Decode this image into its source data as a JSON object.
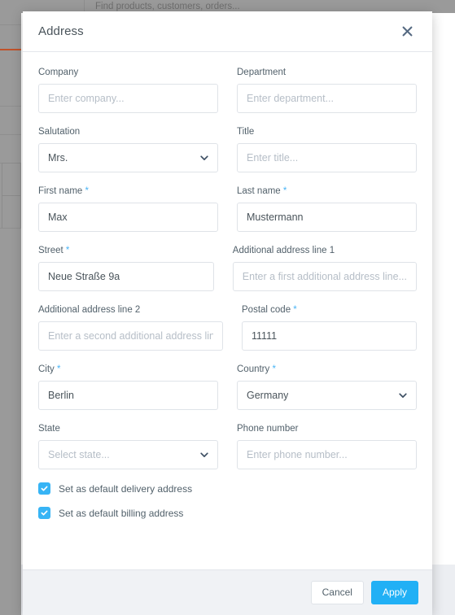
{
  "background": {
    "search_placeholder": "Find products, customers, orders...",
    "accent_color": "#c0522a",
    "overlay_color": "#9a9a9a"
  },
  "modal": {
    "title": "Address",
    "close_icon": "close-icon",
    "accent_color": "#21b0f5",
    "required_marker": "*",
    "rows": [
      {
        "left": {
          "label": "Company",
          "required": false,
          "type": "text",
          "value": "",
          "placeholder": "Enter company..."
        },
        "right": {
          "label": "Department",
          "required": false,
          "type": "text",
          "value": "",
          "placeholder": "Enter department..."
        }
      },
      {
        "left": {
          "label": "Salutation",
          "required": false,
          "type": "select",
          "value": "Mrs.",
          "placeholder": ""
        },
        "right": {
          "label": "Title",
          "required": false,
          "type": "text",
          "value": "",
          "placeholder": "Enter title..."
        }
      },
      {
        "left": {
          "label": "First name",
          "required": true,
          "type": "text",
          "value": "Max",
          "placeholder": ""
        },
        "right": {
          "label": "Last name",
          "required": true,
          "type": "text",
          "value": "Mustermann",
          "placeholder": ""
        }
      },
      {
        "left": {
          "label": "Street",
          "required": true,
          "type": "text",
          "value": "Neue Straße 9a",
          "placeholder": ""
        },
        "right": {
          "label": "Additional address line 1",
          "required": false,
          "type": "text",
          "value": "",
          "placeholder": "Enter a first additional address line..."
        }
      },
      {
        "left": {
          "label": "Additional address line 2",
          "required": false,
          "type": "text",
          "value": "",
          "placeholder": "Enter a second additional address line..."
        },
        "right": {
          "label": "Postal code",
          "required": true,
          "type": "text",
          "value": "11111",
          "placeholder": ""
        }
      },
      {
        "left": {
          "label": "City",
          "required": true,
          "type": "text",
          "value": "Berlin",
          "placeholder": ""
        },
        "right": {
          "label": "Country",
          "required": true,
          "type": "select",
          "value": "Germany",
          "placeholder": ""
        }
      },
      {
        "left": {
          "label": "State",
          "required": false,
          "type": "select",
          "value": "",
          "placeholder": "Select state..."
        },
        "right": {
          "label": "Phone number",
          "required": false,
          "type": "text",
          "value": "",
          "placeholder": "Enter phone number..."
        }
      }
    ],
    "checkboxes": [
      {
        "label": "Set as default delivery address",
        "checked": true
      },
      {
        "label": "Set as default billing address",
        "checked": true
      }
    ],
    "footer": {
      "cancel_label": "Cancel",
      "apply_label": "Apply"
    }
  }
}
